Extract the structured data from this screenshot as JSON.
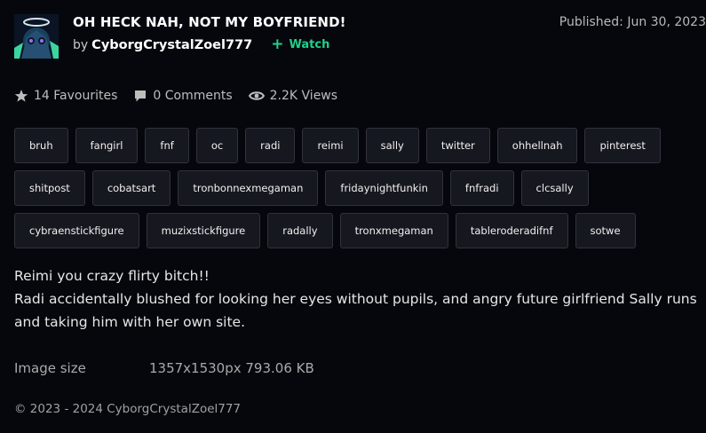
{
  "header": {
    "title": "OH HECK NAH, NOT MY BOYFRIEND!",
    "by_label": "by",
    "author": "CyborgCrystalZoel777",
    "watch_label": "Watch",
    "published": "Published: Jun 30, 2023"
  },
  "stats": {
    "favourites": "14 Favourites",
    "comments": "0 Comments",
    "views": "2.2K Views"
  },
  "tags": [
    "bruh",
    "fangirl",
    "fnf",
    "oc",
    "radi",
    "reimi",
    "sally",
    "twitter",
    "ohhellnah",
    "pinterest",
    "shitpost",
    "cobatsart",
    "tronbonnexmegaman",
    "fridaynightfunkin",
    "fnfradi",
    "clcsally",
    "cybraenstickfigure",
    "muzixstickfigure",
    "radally",
    "tronxmegaman",
    "tableroderadifnf",
    "sotwe"
  ],
  "description": {
    "line1": "Reimi you crazy flirty bitch!!",
    "line2": "Radi accidentally blushed for looking her eyes without pupils, and angry future girlfriend Sally runs and taking him with her own site."
  },
  "details": {
    "image_size_label": "Image size",
    "image_size_value": "1357x1530px 793.06 KB"
  },
  "footer": {
    "copyright": "© 2023 - 2024 CyborgCrystalZoel777"
  },
  "colors": {
    "background": "#06070d",
    "accent_watch": "#1fd18a",
    "tag_bg": "#16181f"
  },
  "icons": {
    "favourites": "star-icon",
    "comments": "comment-icon",
    "views": "eye-icon",
    "watch": "plus-icon"
  }
}
